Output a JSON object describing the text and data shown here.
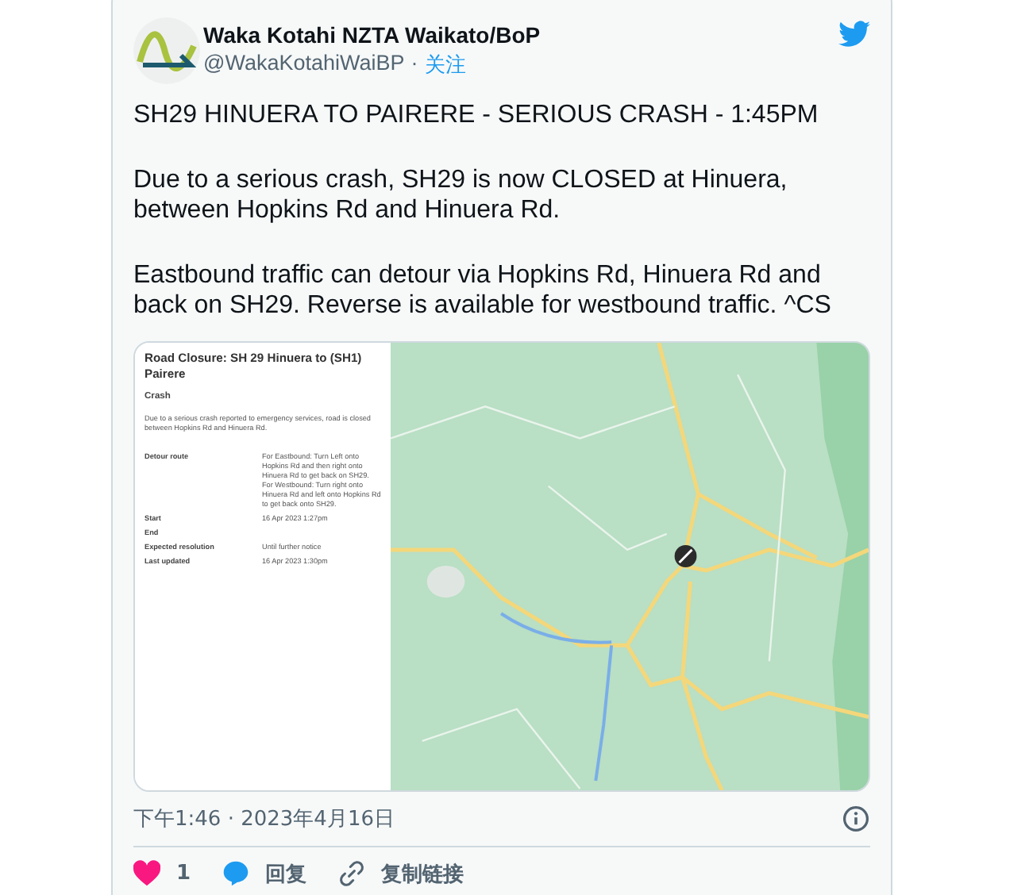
{
  "author": {
    "name": "Waka Kotahi NZTA Waikato/BoP",
    "handle": "@WakaKotahiWaiBP",
    "separator": "·",
    "follow": "关注"
  },
  "paragraphs": [
    "SH29 HINUERA TO PAIRERE - SERIOUS CRASH - 1:45PM",
    "Due to a serious crash, SH29 is now CLOSED at Hinuera, between Hopkins Rd and Hinuera Rd.",
    "Eastbound traffic can detour via Hopkins Rd, Hinuera Rd and back on SH29. Reverse is available for westbound traffic. ^CS"
  ],
  "panel": {
    "title": "Road Closure: SH 29 Hinuera to (SH1) Pairere",
    "type": "Crash",
    "description": "Due to a serious crash reported to emergency services, road is closed between Hopkins Rd and Hinuera Rd.",
    "rows": [
      {
        "label": "Detour route",
        "value": "For Eastbound: Turn Left onto Hopkins Rd and then right onto Hinuera Rd to get back on SH29. For Westbound: Turn right onto Hinuera Rd and left onto Hopkins Rd to get back onto SH29."
      },
      {
        "label": "Start",
        "value": "16 Apr 2023 1:27pm"
      },
      {
        "label": "End"
      },
      {
        "label": "Expected resolution",
        "value": "Until further notice"
      },
      {
        "label": "Last updated",
        "value": "16 Apr 2023 1:30pm"
      }
    ]
  },
  "timestamp": "下午1:46 · 2023年4月16日",
  "actions": [
    {
      "kind": "like",
      "label": "1"
    },
    {
      "kind": "reply",
      "label": "回复"
    },
    {
      "kind": "link",
      "label": "复制链接"
    }
  ]
}
